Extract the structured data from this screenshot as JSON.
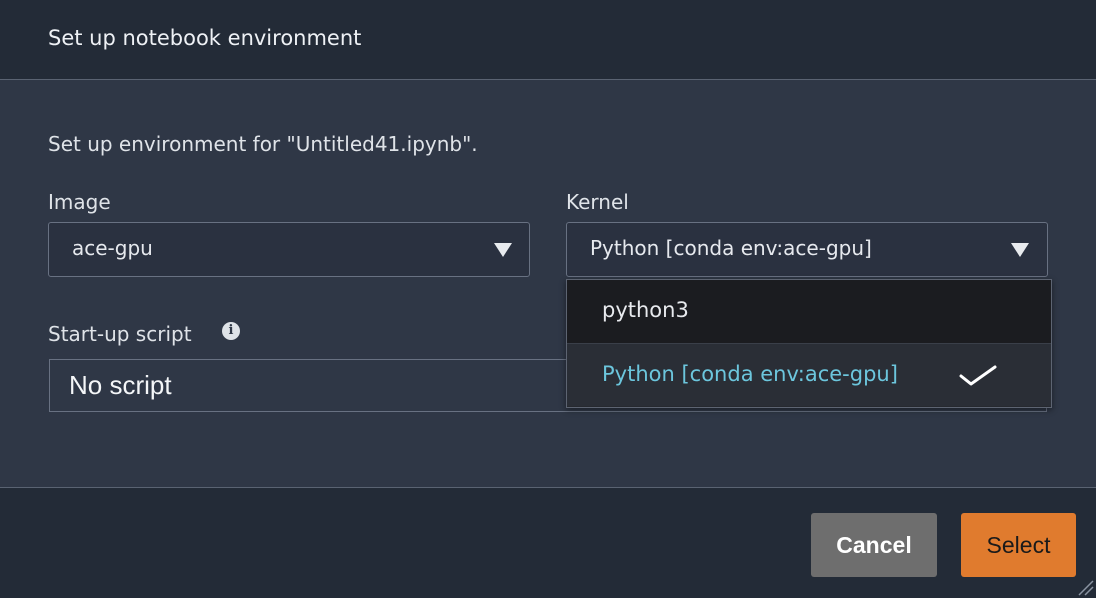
{
  "dialog": {
    "title": "Set up notebook environment",
    "description": "Set up environment for \"Untitled41.ipynb\"."
  },
  "image_field": {
    "label": "Image",
    "value": "ace-gpu",
    "icon": "chevron-down-icon"
  },
  "kernel_field": {
    "label": "Kernel",
    "value": "Python [conda env:ace-gpu]",
    "icon": "chevron-down-icon",
    "options": [
      {
        "label": "python3",
        "selected": false
      },
      {
        "label": "Python [conda env:ace-gpu]",
        "selected": true
      }
    ]
  },
  "startup_script": {
    "label": "Start-up script",
    "info_glyph": "i",
    "value": "No script"
  },
  "footer": {
    "cancel_label": "Cancel",
    "select_label": "Select"
  },
  "colors": {
    "accent": "#e07b2e",
    "selected_option_text": "#6cc6dd",
    "background": "#2f3746",
    "header_background": "#232b37"
  }
}
